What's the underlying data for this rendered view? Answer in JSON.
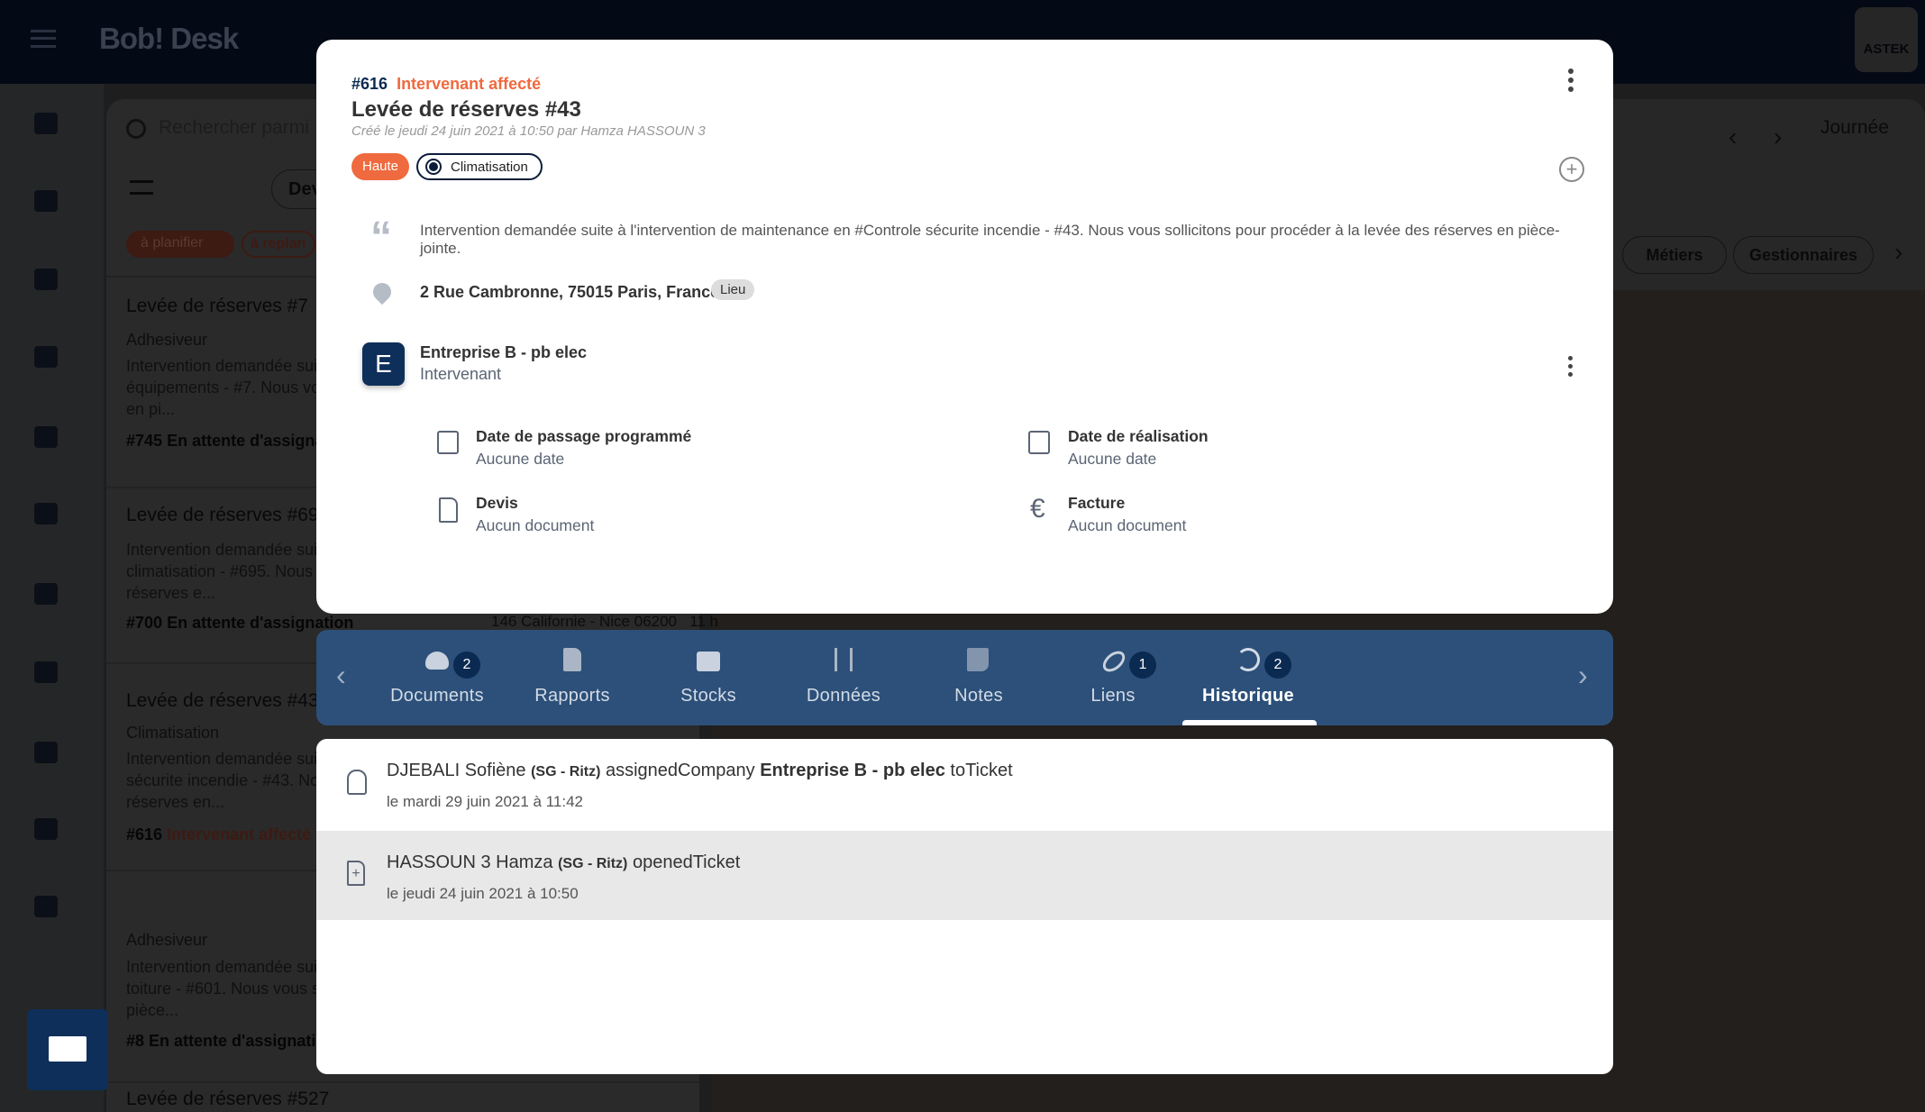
{
  "app": {
    "logo": "Bob! Desk",
    "brand_logo": "ASTEK GROUP"
  },
  "colors": {
    "accent": "#ef6a3e",
    "navy": "#0e2f5a",
    "tabbar": "#2c5079"
  },
  "background": {
    "search_placeholder": "Rechercher parmi",
    "filter_chip_partial": "Dev",
    "status_chips": [
      "à planifier",
      "à replan"
    ],
    "cards": [
      {
        "title": "Levée de réserves #7",
        "sub": "Adhesiveur",
        "desc": "Intervention demandée sui\néquipements - #7. Nous vo\nen pi...",
        "id": "#745",
        "status": "En attente d'assigna"
      },
      {
        "title": "Levée de réserves #69",
        "sub": "",
        "desc": "Intervention demandée sui\nclimatisation - #695. Nous\nréserves e...",
        "id": "#700",
        "status": "En attente d'assignation"
      },
      {
        "title": "Levée de réserves #43",
        "sub": "Climatisation",
        "desc": "Intervention demandée sui\nsécurite incendie - #43. No\nréserves en...",
        "id": "#616",
        "status": "Intervenant affecté"
      },
      {
        "title": "",
        "sub": "Adhesiveur",
        "desc": "Intervention demandée sui\ntoiture - #601. Nous vous s\npièce...",
        "id": "#8",
        "status": "En attente d'assignatio"
      },
      {
        "title": "Levée de réserves #527",
        "sub": "",
        "desc": "",
        "id": "",
        "status": ""
      }
    ],
    "address_partial": "146 Californie - Nice 06200",
    "time_partial": "11 h",
    "view_mode": "Journée",
    "right_chips": [
      "Métiers",
      "Gestionnaires"
    ]
  },
  "modal": {
    "ticket_id": "#616",
    "status": "Intervenant affecté",
    "title": "Levée de réserves #43",
    "created": "Créé le jeudi 24 juin 2021 à 10:50 par Hamza HASSOUN 3",
    "priority": "Haute",
    "category": "Climatisation",
    "description": "Intervention demandée suite à l'intervention de maintenance en #Controle sécurite incendie - #43. Nous vous sollicitons pour procéder à la levée des réserves en pièce-jointe.",
    "address": "2 Rue Cambronne, 75015 Paris, France",
    "address_tag": "Lieu",
    "company": {
      "initial": "E",
      "name": "Entreprise B - pb elec",
      "role": "Intervenant"
    },
    "details": [
      {
        "icon": "calendar-icon",
        "label": "Date de passage programmé",
        "value": "Aucune date"
      },
      {
        "icon": "calendar-icon",
        "label": "Date de réalisation",
        "value": "Aucune date"
      },
      {
        "icon": "document-search-icon",
        "label": "Devis",
        "value": "Aucun document"
      },
      {
        "icon": "euro-icon",
        "label": "Facture",
        "value": "Aucun document"
      }
    ]
  },
  "tabs": [
    {
      "label": "Documents",
      "icon": "cloud-icon",
      "badge": "2"
    },
    {
      "label": "Rapports",
      "icon": "report-icon",
      "badge": ""
    },
    {
      "label": "Stocks",
      "icon": "box-icon",
      "badge": ""
    },
    {
      "label": "Données",
      "icon": "sliders-icon",
      "badge": ""
    },
    {
      "label": "Notes",
      "icon": "note-icon",
      "badge": ""
    },
    {
      "label": "Liens",
      "icon": "link-icon",
      "badge": "1"
    },
    {
      "label": "Historique",
      "icon": "history-icon",
      "badge": "2",
      "active": true
    }
  ],
  "history": [
    {
      "user": "DJEBALI Sofiène",
      "org": "(SG - Ritz)",
      "action": "assignedCompany",
      "target": "Entreprise B - pb elec",
      "suffix": "toTicket",
      "date": "le mardi 29 juin 2021 à 11:42",
      "icon": "worker-icon"
    },
    {
      "user": "HASSOUN 3 Hamza",
      "org": "(SG - Ritz)",
      "action": "openedTicket",
      "target": "",
      "suffix": "",
      "date": "le jeudi 24 juin 2021 à 10:50",
      "icon": "file-plus-icon"
    }
  ]
}
